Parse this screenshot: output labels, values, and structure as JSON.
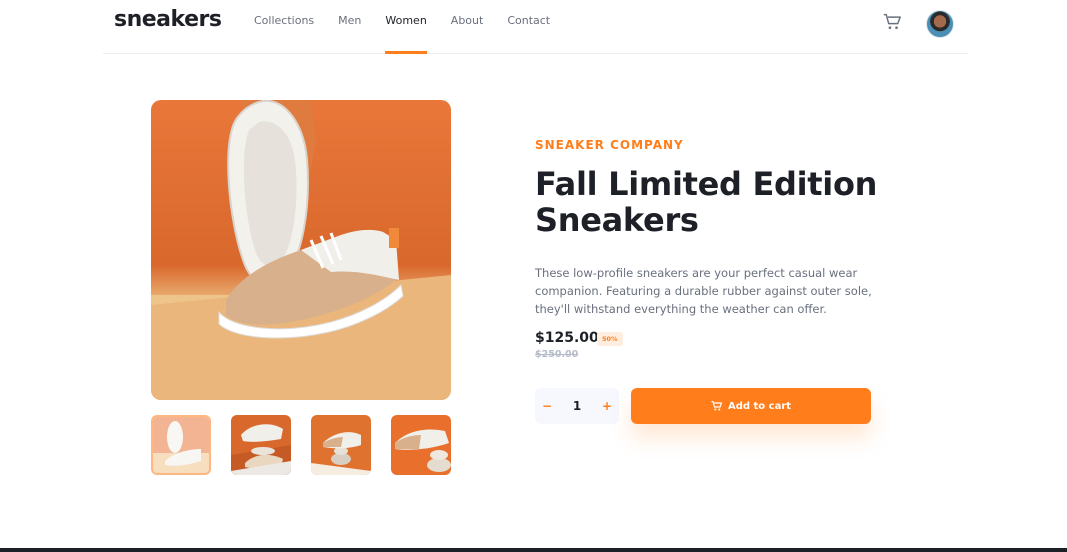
{
  "header": {
    "logo": "sneakers",
    "nav": [
      {
        "label": "Collections",
        "active": false
      },
      {
        "label": "Men",
        "active": false
      },
      {
        "label": "Women",
        "active": true
      },
      {
        "label": "About",
        "active": false
      },
      {
        "label": "Contact",
        "active": false
      }
    ],
    "cart_icon": "cart-icon",
    "avatar": "user-avatar"
  },
  "gallery": {
    "main_image": "sneaker-product-photo",
    "thumbnails": [
      {
        "name": "thumbnail-1",
        "active": true
      },
      {
        "name": "thumbnail-2",
        "active": false
      },
      {
        "name": "thumbnail-3",
        "active": false
      },
      {
        "name": "thumbnail-4",
        "active": false
      }
    ]
  },
  "product": {
    "brand": "SNEAKER COMPANY",
    "title": "Fall Limited Edition Sneakers",
    "description": "These low-profile sneakers are your perfect casual wear companion. Featuring a durable rubber against outer sole, they'll withstand everything the weather can offer.",
    "price": "$125.00",
    "discount": "50%",
    "original_price": "$250.00"
  },
  "cart": {
    "minus": "−",
    "quantity": "1",
    "plus": "+",
    "add_label": "Add to cart"
  },
  "colors": {
    "accent": "#ff7e1b",
    "accent_pale": "#ffede0",
    "dark": "#1d2026",
    "grey": "#69707d"
  }
}
